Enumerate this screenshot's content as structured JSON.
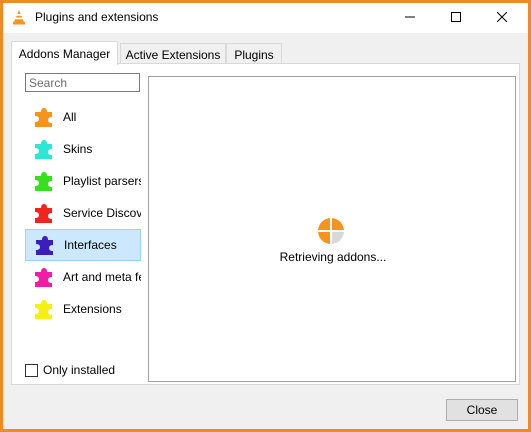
{
  "window": {
    "title": "Plugins and extensions",
    "border_color": "#f08a24",
    "icons": {
      "app": "vlc-cone-icon",
      "minimize": "minimize-icon",
      "maximize": "maximize-icon",
      "close": "close-icon"
    }
  },
  "tabs": [
    {
      "label": "Addons Manager",
      "active": true
    },
    {
      "label": "Active Extensions",
      "active": false
    },
    {
      "label": "Plugins",
      "active": false
    }
  ],
  "search": {
    "placeholder": "Search",
    "value": ""
  },
  "categories": [
    {
      "label": "All",
      "icon": "puzzle-icon",
      "color": "#f7941d",
      "selected": false
    },
    {
      "label": "Skins",
      "icon": "puzzle-icon",
      "color": "#2ee6d6",
      "selected": false
    },
    {
      "label": "Playlist parsers",
      "icon": "puzzle-icon",
      "color": "#35e01c",
      "selected": false
    },
    {
      "label": "Service Discove",
      "icon": "puzzle-icon",
      "color": "#f0241c",
      "selected": false
    },
    {
      "label": "Interfaces",
      "icon": "puzzle-icon",
      "color": "#3b1fb8",
      "selected": true
    },
    {
      "label": "Art and meta fe",
      "icon": "puzzle-icon",
      "color": "#f01ea6",
      "selected": false
    },
    {
      "label": "Extensions",
      "icon": "puzzle-icon",
      "color": "#f6ef12",
      "selected": false
    }
  ],
  "only_installed": {
    "label": "Only installed",
    "checked": false
  },
  "content": {
    "status": "Retrieving addons...",
    "spinner_icon": "loading-spinner-icon"
  },
  "footer": {
    "close_label": "Close"
  },
  "colors": {
    "selection_bg": "#cce8ff",
    "selection_border": "#99d1ff",
    "spinner_orange": "#f7941d"
  }
}
